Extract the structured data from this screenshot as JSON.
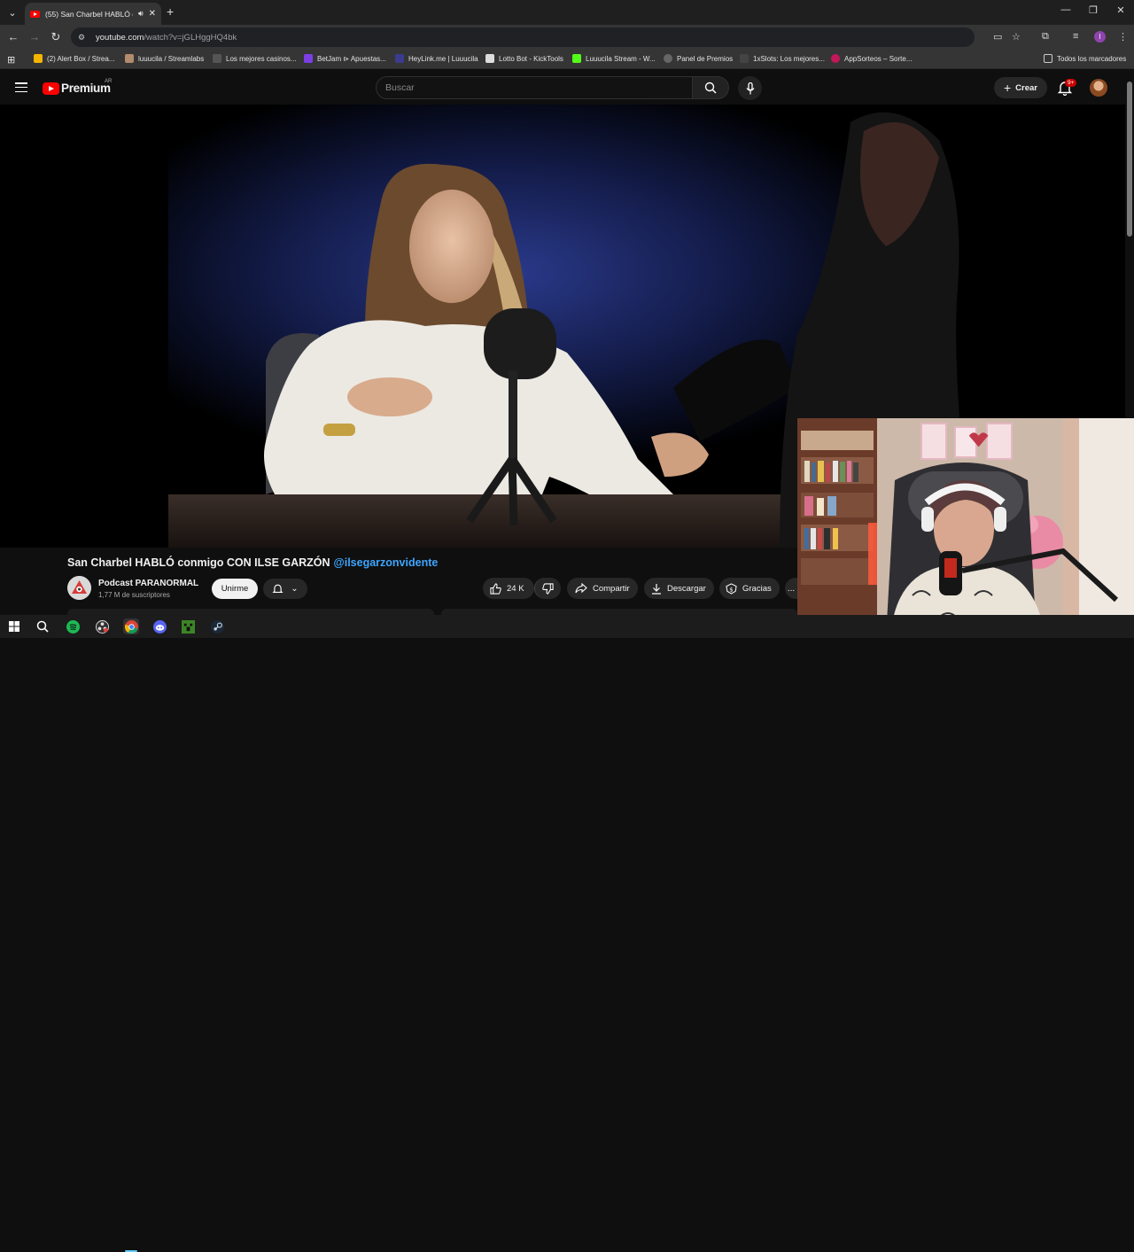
{
  "browser": {
    "active_tab_title": "(55) San Charbel HABLÓ co",
    "url_host": "youtube.com",
    "url_path": "/watch?v=jGLHggHQ4bk",
    "bookmarks": [
      "(2) Alert Box / Strea...",
      "luuucila / Streamlabs",
      "Los mejores casinos...",
      "BetJam ⊳ Apuestas...",
      "HeyLink.me | Luuucila",
      "Lotto Bot - KickTools",
      "Luuucila Stream - W...",
      "Panel de Premios",
      "1xSlots: Los mejores...",
      "AppSorteos – Sorte..."
    ],
    "all_bookmarks_label": "Todos los marcadores",
    "profile_initial": "l"
  },
  "youtube": {
    "logo_text": "Premium",
    "region": "AR",
    "search_placeholder": "Buscar",
    "create_label": "Crear",
    "notifications_badge": "9+",
    "video": {
      "title": "San Charbel HABLÓ conmigo CON ILSE GARZÓN",
      "mention": "@ilsegarzonvidente",
      "channel_name": "Podcast PARANORMAL",
      "subscribers": "1,77 M de suscriptores",
      "join_label": "Unirme",
      "likes": "24 K",
      "share_label": "Compartir",
      "download_label": "Descargar",
      "thanks_label": "Gracias",
      "more_label": "..."
    }
  },
  "colors": {
    "yt_red": "#ff0000",
    "link_blue": "#3ea6ff",
    "background": "#0f0f0f",
    "chrome_dark": "#1f1f1f",
    "chrome_toolbar": "#353535"
  }
}
